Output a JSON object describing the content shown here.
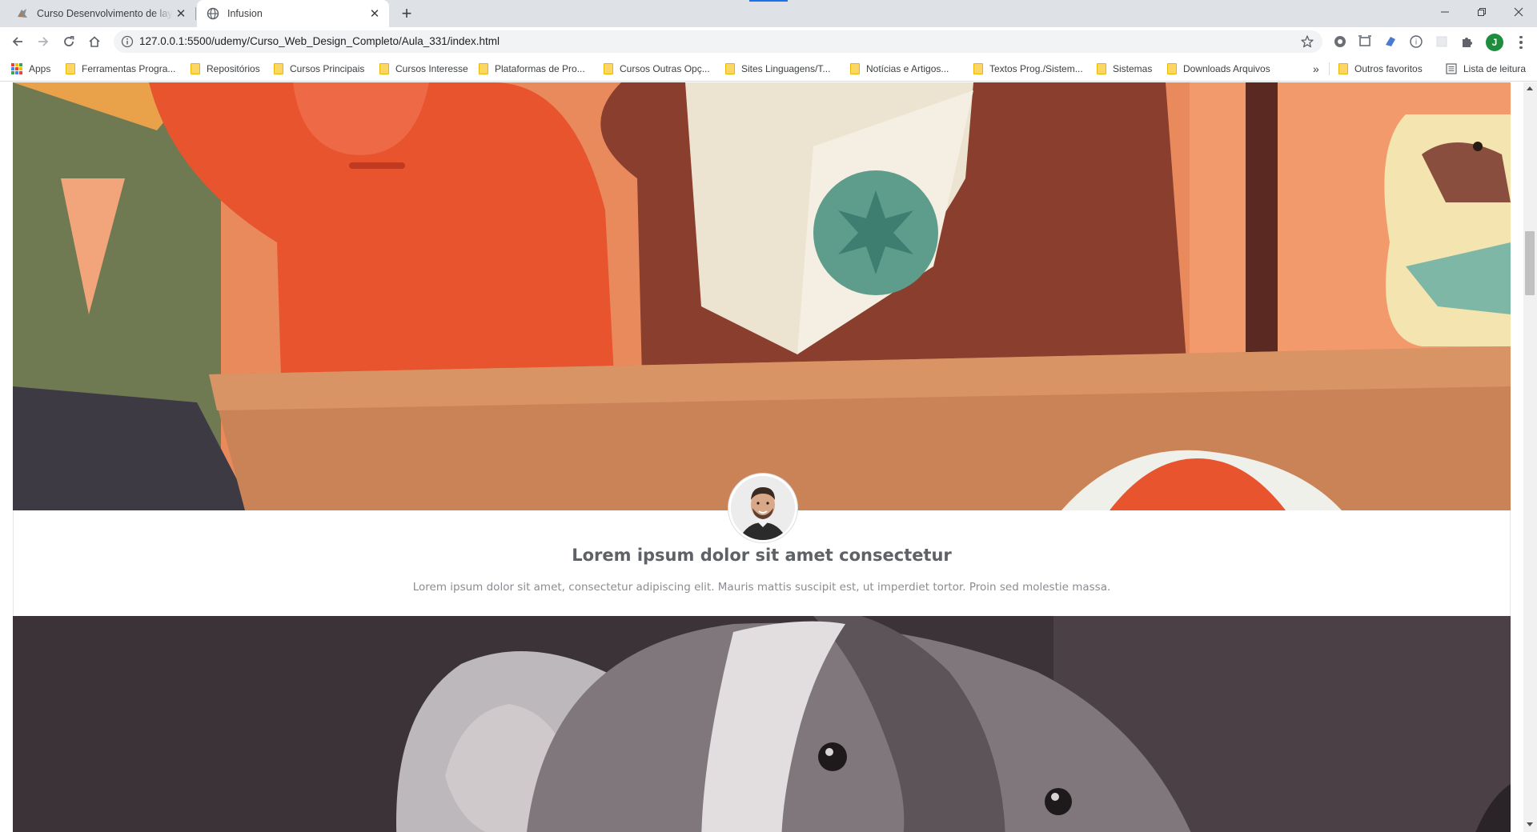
{
  "browser": {
    "tabs": [
      {
        "title": "Curso Desenvolvimento de layou",
        "active": false,
        "icon": "course-favicon-icon"
      },
      {
        "title": "Infusion",
        "active": true,
        "icon": "globe-icon"
      }
    ],
    "new_tab_label": "+",
    "url": "127.0.0.1:5500/udemy/Curso_Web_Design_Completo/Aula_331/index.html",
    "profile_initial": "J",
    "bookmarks": [
      {
        "label": "Apps",
        "icon": "apps-grid-icon"
      },
      {
        "label": "Ferramentas Progra...",
        "icon": "folder-icon"
      },
      {
        "label": "Repositórios",
        "icon": "folder-icon"
      },
      {
        "label": "Cursos Principais",
        "icon": "folder-icon"
      },
      {
        "label": "Cursos Interesse",
        "icon": "folder-icon"
      },
      {
        "label": "Plataformas de Pro...",
        "icon": "folder-icon"
      },
      {
        "label": "Cursos Outras Opç...",
        "icon": "folder-icon"
      },
      {
        "label": "Sites Linguagens/T...",
        "icon": "folder-icon"
      },
      {
        "label": "Notícias e Artigos...",
        "icon": "folder-icon"
      },
      {
        "label": "Textos Prog./Sistem...",
        "icon": "folder-icon"
      },
      {
        "label": "Sistemas",
        "icon": "folder-icon"
      },
      {
        "label": "Downloads Arquivos",
        "icon": "folder-icon"
      }
    ],
    "bookmarks_overflow": "»",
    "other_bookmarks": "Outros favoritos",
    "reading_list": "Lista de leitura"
  },
  "page": {
    "card": {
      "title": "Lorem ipsum dolor sit amet consectetur",
      "text": "Lorem ipsum dolor sit amet, consectetur adipiscing elit. Mauris mattis suscipit est, ut imperdiet tortor. Proin sed molestie massa."
    }
  },
  "colors": {
    "tab_strip": "#dee1e6",
    "title_text": "#5e6166",
    "body_text": "#8a8d92"
  }
}
